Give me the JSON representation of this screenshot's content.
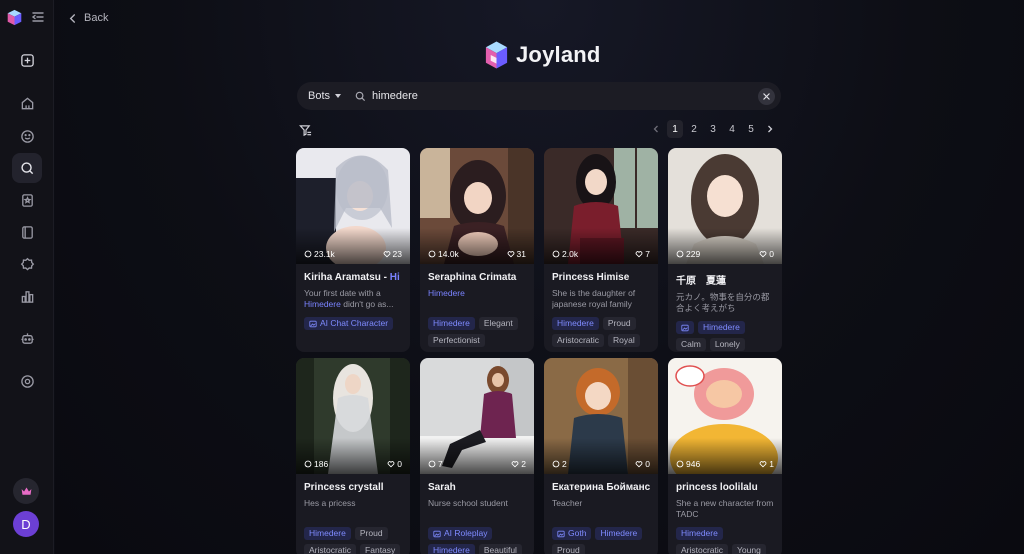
{
  "back_label": "Back",
  "brand": {
    "name": "Joyland"
  },
  "search": {
    "type_label": "Bots",
    "query": "himedere"
  },
  "pagination": {
    "pages": [
      "1",
      "2",
      "3",
      "4",
      "5"
    ],
    "current": "1"
  },
  "user": {
    "initial": "D"
  },
  "colors": {
    "accent": "#7a83ff",
    "avatar": "#6c3fd4",
    "background": "#0c0d14",
    "card": "#1a1a22"
  },
  "cards": [
    {
      "name": "Kiriha Aramatsu - ",
      "name_highlight": "Hi",
      "chats": "23.1k",
      "likes": "23",
      "desc_pre": "Your first date with a ",
      "desc_highlight": "Himedere",
      "desc_post": " didn't go as...",
      "tags": [
        "AI Chat Character"
      ]
    },
    {
      "name": "Seraphina Crimata",
      "chats": "14.0k",
      "likes": "31",
      "desc_highlight": "Himedere",
      "tags": [
        "Himedere",
        "Elegant",
        "Perfectionist"
      ]
    },
    {
      "name": "Princess Himise",
      "chats": "2.0k",
      "likes": "7",
      "desc": "She is the daughter of japanese royal family",
      "tags": [
        "Himedere",
        "Proud",
        "Aristocratic",
        "Royal"
      ]
    },
    {
      "name": "千原　夏蓮",
      "chats": "229",
      "likes": "0",
      "desc": "元カノ。物事を自分の都合よく考えがち",
      "tags": [
        "Himedere",
        "Calm",
        "Lonely"
      ]
    },
    {
      "name": "Princess crystall",
      "chats": "186",
      "likes": "0",
      "desc": "Hes a pricess",
      "tags": [
        "Himedere",
        "Proud",
        "Aristocratic",
        "Fantasy"
      ]
    },
    {
      "name": "Sarah",
      "chats": "7",
      "likes": "2",
      "desc": "Nurse school student",
      "tags": [
        "AI Roleplay",
        "Himedere",
        "Beautiful"
      ]
    },
    {
      "name": "Екатерина Бойманс",
      "chats": "2",
      "likes": "0",
      "desc": "Teacher",
      "tags": [
        "Goth",
        "Himedere",
        "Proud"
      ]
    },
    {
      "name": "princess loolilalu",
      "chats": "946",
      "likes": "1",
      "desc": "She a new character from TADC",
      "tags": [
        "Himedere",
        "Aristocratic",
        "Young"
      ]
    }
  ]
}
